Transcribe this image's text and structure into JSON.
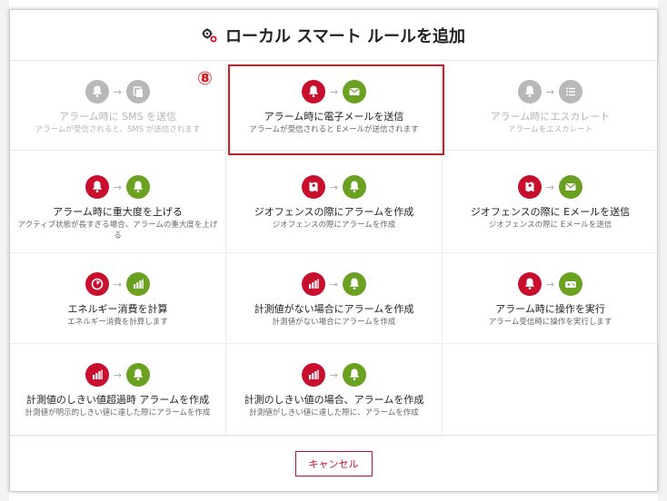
{
  "dialog": {
    "title": "ローカル スマート ルールを追加",
    "cancel_label": "キャンセル",
    "marker": "⑧"
  },
  "colors": {
    "red": "#c8102e",
    "green": "#6aa121",
    "gray": "#b8b8b8"
  },
  "cards": [
    {
      "title": "アラーム時に SMS を送信",
      "desc": "アラームが受信されると、SMS が送信されます",
      "from": "bell",
      "to": "copy",
      "disabled": true
    },
    {
      "title": "アラーム時に電子メールを送信",
      "desc": "アラームが受信されると Eメールが送信されます",
      "from": "bell",
      "to": "envelope",
      "disabled": false
    },
    {
      "title": "アラーム時にエスカレート",
      "desc": "アラームをエスカレート",
      "from": "bell",
      "to": "list",
      "disabled": true
    },
    {
      "title": "アラーム時に重大度を上げる",
      "desc": "アクティブ状態が長すぎる場合、アラームの重大度を上げる",
      "from": "bell",
      "to": "bell",
      "disabled": false
    },
    {
      "title": "ジオフェンスの際にアラームを作成",
      "desc": "ジオフェンスの際にアラームを作成",
      "from": "geofence",
      "to": "bell",
      "disabled": false
    },
    {
      "title": "ジオフェンスの際に Eメールを送信",
      "desc": "ジオフェンスの際に Eメールを送信",
      "from": "geofence",
      "to": "envelope",
      "disabled": false
    },
    {
      "title": "エネルギー消費を計算",
      "desc": "エネルギー消費を計算します",
      "from": "gauge",
      "to": "chart",
      "disabled": false
    },
    {
      "title": "計測値がない場合にアラームを作成",
      "desc": "計測値がない場合にアラームを作成",
      "from": "chart",
      "to": "bell",
      "disabled": false
    },
    {
      "title": "アラーム時に操作を実行",
      "desc": "アラーム受信時に操作を実行します",
      "from": "bell",
      "to": "gamepad",
      "disabled": false
    },
    {
      "title": "計測値のしきい値超過時 アラームを作成",
      "desc": "計測値が明示的しきい値に達した際にアラームを作成",
      "from": "chart",
      "to": "bell",
      "disabled": false
    },
    {
      "title": "計測のしきい値の場合、アラームを作成",
      "desc": "計測値がしきい値に達した際に、アラームを作成",
      "from": "chart",
      "to": "bell",
      "disabled": false
    }
  ]
}
